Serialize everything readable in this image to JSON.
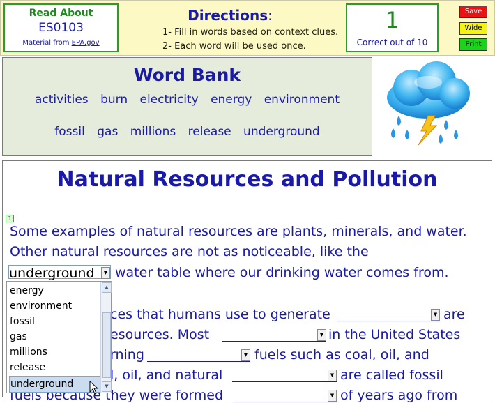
{
  "header": {
    "read_about": "Read About",
    "code": "ES0103",
    "material_prefix": "Material from ",
    "material_link": "EPA.gov",
    "directions_title": "Directions",
    "directions_colon": ":",
    "directions": [
      "1- Fill in words based on context clues.",
      "2- Each word will be used once."
    ],
    "score": "1",
    "score_label": "Correct out of 10",
    "buttons": {
      "save": "Save",
      "wide": "Wide",
      "print": "Print"
    }
  },
  "word_bank": {
    "title": "Word Bank",
    "row1": [
      "activities",
      "burn",
      "electricity",
      "energy",
      "environment"
    ],
    "row2": [
      "fossil",
      "gas",
      "millions",
      "release",
      "underground"
    ]
  },
  "passage": {
    "title": "Natural Resources and Pollution",
    "paragraph_number": "1",
    "line1": "Some examples of natural resources are plants, minerals, and water.",
    "line2": "Other natural resources are not as noticeable, like the",
    "selected_value": "underground",
    "line3_after": "water table where our drinking water comes from.",
    "line4_a": "ces that humans use to generate",
    "line4_b": "are",
    "line5_a": "esources.  Most",
    "line5_b": "in the United States",
    "line6_a": "rning",
    "line6_b": "fuels such as coal, oil, and",
    "line7_a": "l, oil, and natural",
    "line7_b": "are called fossil",
    "line8_a": "fuels because they were formed",
    "line8_b": "of years ago from"
  },
  "dropdown_options": [
    "energy",
    "environment",
    "fossil",
    "gas",
    "millions",
    "release",
    "underground"
  ],
  "selected_index": 6,
  "icons": {
    "cloud": "storm-cloud-icon",
    "dropdown_arrow": "chevron-down-icon",
    "scroll_up": "chevron-up-icon",
    "scroll_down": "chevron-down-icon",
    "cursor": "mouse-pointer-icon"
  },
  "colors": {
    "accent_blue": "#1a1aa8",
    "green": "#1c8a1c",
    "header_bg": "#fdf9c4",
    "wordbank_bg": "#e6ecdc",
    "save_red": "#ee1111",
    "wide_yellow": "#f7f311",
    "print_green": "#19d419"
  }
}
